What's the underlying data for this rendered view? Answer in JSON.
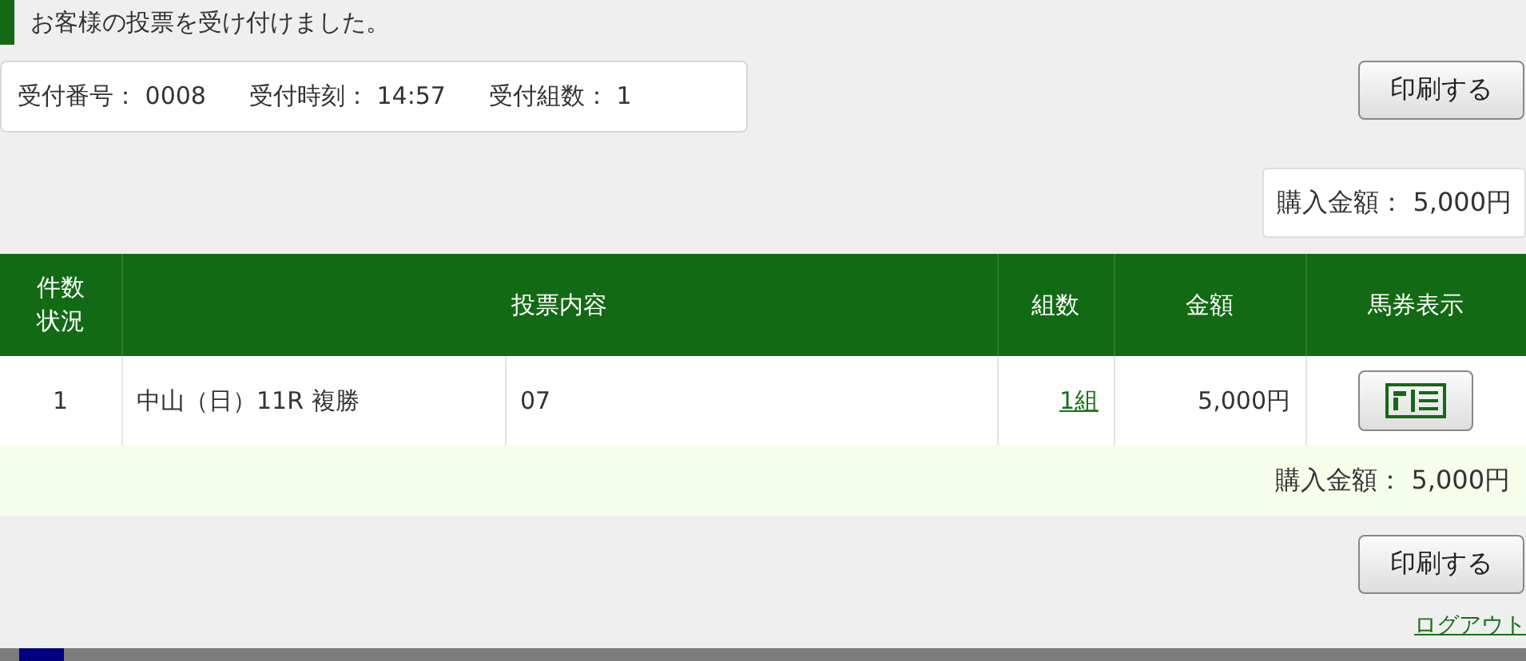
{
  "message": "お客様の投票を受け付けました。",
  "receipt": [
    {
      "label": "受付番号：",
      "value": "0008"
    },
    {
      "label": "受付時刻：",
      "value": "14:57"
    },
    {
      "label": "受付組数：",
      "value": "1"
    }
  ],
  "print_button": "印刷する",
  "total_top": {
    "label": "購入金額：",
    "value": "5,000円"
  },
  "table": {
    "columns": [
      {
        "label": "件数状況"
      },
      {
        "label": "投票内容"
      },
      {
        "label": "組数"
      },
      {
        "label": "金額"
      },
      {
        "label": "馬券表示"
      }
    ],
    "rows": [
      {
        "count": "1",
        "race": "中山（日）11R 複勝",
        "numbers": "07",
        "sets": "1組",
        "amount": "5,000円"
      }
    ],
    "total": {
      "label": "購入金額：",
      "value": "5,000円"
    }
  },
  "print_button_bottom": "印刷する",
  "logout": "ログアウト"
}
